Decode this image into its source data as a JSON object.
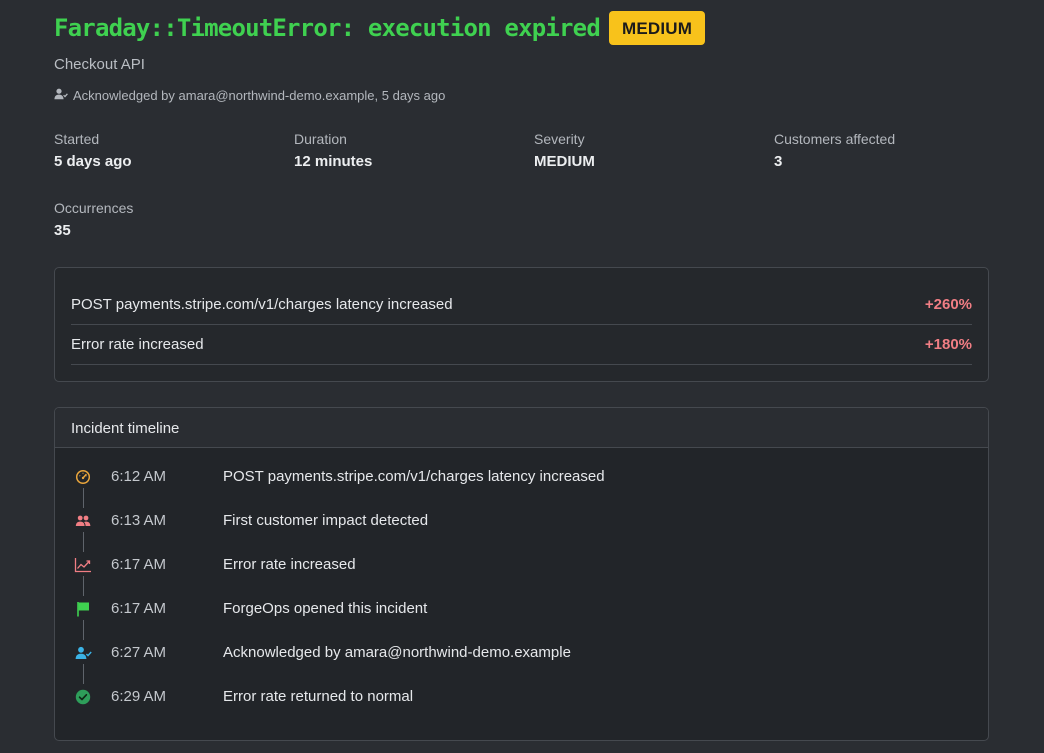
{
  "incident": {
    "title": "Faraday::TimeoutError: execution expired",
    "severity_badge": "MEDIUM",
    "service": "Checkout API",
    "acknowledged": "Acknowledged by amara@northwind-demo.example, 5 days ago",
    "ack_icon": "user-check-icon"
  },
  "stats": [
    {
      "label": "Started",
      "value": "5 days ago"
    },
    {
      "label": "Duration",
      "value": "12 minutes"
    },
    {
      "label": "Severity",
      "value": "MEDIUM"
    },
    {
      "label": "Customers affected",
      "value": "3"
    },
    {
      "label": "Occurrences",
      "value": "35"
    }
  ],
  "signals": [
    {
      "text": "POST payments.stripe.com/v1/charges latency increased",
      "delta": "+260%"
    },
    {
      "text": "Error rate increased",
      "delta": "+180%"
    }
  ],
  "timeline": {
    "heading": "Incident timeline",
    "events": [
      {
        "time": "6:12 AM",
        "text": "POST payments.stripe.com/v1/charges latency increased",
        "icon": "gauge-icon",
        "color": "#e9a53c"
      },
      {
        "time": "6:13 AM",
        "text": "First customer impact detected",
        "icon": "users-icon",
        "color": "#f17e84"
      },
      {
        "time": "6:17 AM",
        "text": "Error rate increased",
        "icon": "trending-up-icon",
        "color": "#f17e84"
      },
      {
        "time": "6:17 AM",
        "text": "ForgeOps opened this incident",
        "icon": "flag-icon",
        "color": "#3fd150"
      },
      {
        "time": "6:27 AM",
        "text": "Acknowledged by amara@northwind-demo.example",
        "icon": "user-check-icon",
        "color": "#3bb3e6"
      },
      {
        "time": "6:29 AM",
        "text": "Error rate returned to normal",
        "icon": "check-circle-icon",
        "color": "#2e9e5a"
      }
    ]
  },
  "colors": {
    "title": "#3fd150",
    "badge": "#f8c21b",
    "delta": "#f17e84",
    "background": "#2a2d32"
  }
}
